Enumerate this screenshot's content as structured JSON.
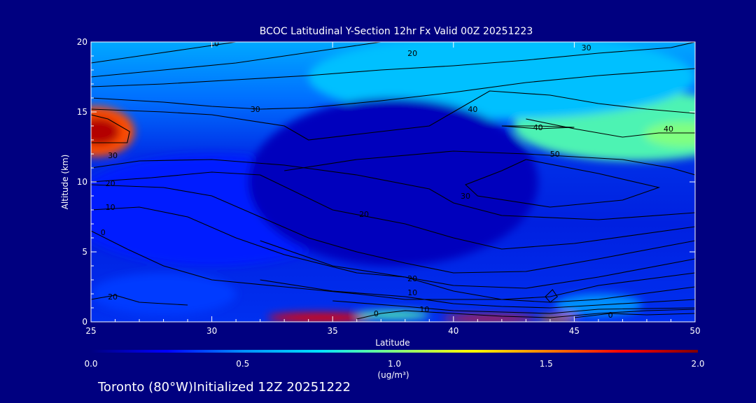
{
  "footer": "Toronto (80°W)Initialized 12Z 20251222",
  "chart_data": {
    "type": "heatmap",
    "title": "BCOC Latitudinal Y-Section 12hr  Fx Valid 00Z 20251223",
    "xlabel": "Latitude",
    "ylabel": "Altitude (km)",
    "xlim": [
      25,
      50
    ],
    "ylim": [
      0,
      20
    ],
    "x_ticks": [
      25,
      30,
      35,
      40,
      45,
      50
    ],
    "y_ticks": [
      0,
      5,
      10,
      15,
      20
    ],
    "colorbar": {
      "label": "(ug/m³)",
      "range": [
        0.0,
        2.0
      ],
      "ticks": [
        "0.0",
        "0.5",
        "1.0",
        "1.5",
        "2.0"
      ],
      "colors": [
        "#000080",
        "#0000ff",
        "#0090ff",
        "#00e0ff",
        "#80ff80",
        "#ffff00",
        "#ff8000",
        "#ff0000",
        "#800000"
      ]
    },
    "contour_lines": [
      {
        "label": "10",
        "points": [
          [
            25,
            18.5
          ],
          [
            27,
            19
          ],
          [
            29,
            19.5
          ],
          [
            31,
            20
          ]
        ],
        "label_at": [
          30.1,
          19.9
        ]
      },
      {
        "label": "20",
        "points": [
          [
            25,
            17.5
          ],
          [
            28,
            18
          ],
          [
            31,
            18.5
          ],
          [
            33,
            19
          ],
          [
            35,
            19.5
          ],
          [
            37,
            20
          ]
        ],
        "label_at": [
          38.3,
          19.2
        ]
      },
      {
        "label": "30",
        "points": [
          [
            25,
            16.8
          ],
          [
            28,
            17
          ],
          [
            31,
            17.3
          ],
          [
            34,
            17.6
          ],
          [
            37,
            18
          ],
          [
            40,
            18.3
          ],
          [
            43,
            18.7
          ],
          [
            46,
            19.2
          ],
          [
            49,
            19.6
          ],
          [
            50,
            20
          ]
        ],
        "label_at": [
          45.5,
          19.6
        ]
      },
      {
        "label": "30",
        "points": [
          [
            25,
            16
          ],
          [
            28,
            15.7
          ],
          [
            30,
            15.4
          ],
          [
            32,
            15.2
          ],
          [
            34,
            15.3
          ],
          [
            37,
            15.8
          ],
          [
            40,
            16.4
          ],
          [
            43,
            17.1
          ],
          [
            46,
            17.6
          ],
          [
            50,
            18.1
          ]
        ],
        "label_at": [
          31.8,
          15.2
        ]
      },
      {
        "label": "40",
        "points": [
          [
            25,
            15.2
          ],
          [
            28,
            15
          ],
          [
            30,
            14.8
          ],
          [
            33,
            14
          ],
          [
            34,
            13
          ],
          [
            36,
            13.4
          ],
          [
            39,
            14
          ],
          [
            40,
            15
          ],
          [
            41.5,
            16.5
          ],
          [
            44,
            16.2
          ],
          [
            46,
            15.6
          ],
          [
            48,
            15.2
          ],
          [
            50,
            14.9
          ]
        ],
        "label_at": [
          40.8,
          15.2
        ]
      },
      {
        "label": "40",
        "points": [
          [
            42,
            14
          ],
          [
            43.5,
            14
          ],
          [
            45,
            13.9
          ],
          [
            43.5,
            13.8
          ],
          [
            42,
            14
          ]
        ],
        "label_at": [
          43.5,
          13.9
        ]
      },
      {
        "label": "40",
        "points": [
          [
            43,
            14.5
          ],
          [
            45,
            13.8
          ],
          [
            47,
            13.2
          ],
          [
            48.5,
            13.5
          ],
          [
            50,
            13.5
          ]
        ],
        "label_at": [
          48.9,
          13.8
        ]
      },
      {
        "label": "30",
        "points": [
          [
            25,
            12.8
          ],
          [
            26.5,
            12.8
          ],
          [
            26.6,
            13.6
          ],
          [
            25.7,
            14.5
          ],
          [
            25,
            14.8
          ]
        ],
        "label_at": [
          25.9,
          11.9
        ]
      },
      {
        "label": "50",
        "points": [
          [
            33,
            10.8
          ],
          [
            36,
            11.6
          ],
          [
            40,
            12.2
          ],
          [
            43,
            12
          ],
          [
            47,
            11.6
          ],
          [
            49,
            11
          ],
          [
            50,
            10.5
          ]
        ],
        "label_at": [
          44.2,
          12
        ]
      },
      {
        "label": "",
        "points": [
          [
            43,
            11.6
          ],
          [
            46,
            10.6
          ],
          [
            48.5,
            9.6
          ],
          [
            47,
            8.7
          ],
          [
            44,
            8.2
          ],
          [
            41,
            9
          ],
          [
            40.5,
            9.8
          ],
          [
            42,
            10.8
          ],
          [
            43,
            11.6
          ]
        ],
        "label_at": null
      },
      {
        "label": "30",
        "points": [
          [
            25,
            11
          ],
          [
            27,
            11.5
          ],
          [
            30,
            11.6
          ],
          [
            33,
            11.2
          ],
          [
            36,
            10.5
          ],
          [
            39,
            9.5
          ],
          [
            40,
            8.5
          ],
          [
            42,
            7.6
          ],
          [
            46,
            7.3
          ],
          [
            50,
            7.8
          ]
        ],
        "label_at": [
          40.5,
          9
        ]
      },
      {
        "label": "20",
        "points": [
          [
            25,
            10
          ],
          [
            27.5,
            10.3
          ],
          [
            30,
            10.7
          ],
          [
            32,
            10.5
          ],
          [
            35,
            8
          ],
          [
            38,
            7
          ],
          [
            40,
            6
          ],
          [
            42,
            5.2
          ],
          [
            45,
            5.6
          ],
          [
            50,
            6.8
          ]
        ],
        "label_at": [
          36.3,
          7.7
        ]
      },
      {
        "label": "20",
        "points": [
          [
            25,
            9.8
          ],
          [
            28,
            9.6
          ],
          [
            30,
            9
          ],
          [
            32,
            7.5
          ],
          [
            34,
            6
          ],
          [
            36,
            5
          ],
          [
            38,
            4.2
          ],
          [
            40,
            3.5
          ],
          [
            43,
            3.6
          ],
          [
            46,
            4.5
          ],
          [
            50,
            5.8
          ]
        ],
        "label_at": [
          25.8,
          9.9
        ]
      },
      {
        "label": "10",
        "points": [
          [
            25,
            8
          ],
          [
            27,
            8.2
          ],
          [
            29,
            7.5
          ],
          [
            31,
            6
          ],
          [
            33,
            4.8
          ],
          [
            36,
            3.5
          ],
          [
            38,
            3.2
          ],
          [
            40,
            2.6
          ],
          [
            43,
            2.4
          ],
          [
            46,
            3.2
          ],
          [
            50,
            4.5
          ]
        ],
        "label_at": [
          25.8,
          8.2
        ]
      },
      {
        "label": "20",
        "points": [
          [
            32,
            5.8
          ],
          [
            35,
            4
          ],
          [
            38,
            3.2
          ],
          [
            40,
            2.2
          ],
          [
            42,
            1.6
          ],
          [
            44,
            1.8
          ],
          [
            46,
            2.6
          ],
          [
            50,
            3.5
          ]
        ],
        "label_at": [
          38.3,
          3.1
        ]
      },
      {
        "label": "0",
        "points": [
          [
            25,
            6.5
          ],
          [
            26.5,
            5.2
          ],
          [
            28,
            4
          ],
          [
            30,
            3
          ],
          [
            33,
            2.5
          ],
          [
            36,
            2
          ],
          [
            38,
            1.6
          ],
          [
            40,
            1.6
          ],
          [
            42,
            1.6
          ],
          [
            44,
            1.4
          ],
          [
            46,
            1.6
          ],
          [
            50,
            2.5
          ]
        ],
        "label_at": [
          25.5,
          6.4
        ]
      },
      {
        "label": "10",
        "points": [
          [
            32,
            3
          ],
          [
            35,
            2.2
          ],
          [
            38,
            1.8
          ],
          [
            40,
            1.3
          ],
          [
            42,
            1.1
          ],
          [
            44,
            1
          ],
          [
            46,
            1.2
          ],
          [
            50,
            1.6
          ]
        ],
        "label_at": [
          38.3,
          2.1
        ]
      },
      {
        "label": "10",
        "points": [
          [
            35,
            1.5
          ],
          [
            38,
            1.1
          ],
          [
            40,
            0.8
          ],
          [
            42,
            0.7
          ],
          [
            44,
            0.6
          ],
          [
            46,
            0.9
          ],
          [
            50,
            1
          ]
        ],
        "label_at": [
          38.8,
          0.9
        ]
      },
      {
        "label": "20",
        "points": [
          [
            25,
            1.6
          ],
          [
            26,
            1.9
          ],
          [
            27,
            1.4
          ],
          [
            29,
            1.2
          ]
        ],
        "label_at": [
          25.9,
          1.8
        ]
      },
      {
        "label": "0",
        "points": [
          [
            36,
            0.2
          ],
          [
            37,
            0.6
          ],
          [
            38,
            0.8
          ],
          [
            40,
            0.6
          ],
          [
            42,
            0.4
          ],
          [
            44,
            0.3
          ],
          [
            46,
            0.6
          ],
          [
            48,
            0.8
          ],
          [
            50,
            0.9
          ]
        ],
        "label_at": [
          36.8,
          0.6
        ]
      },
      {
        "label": "0",
        "points": [
          [
            45,
            0.3
          ],
          [
            46.5,
            0.6
          ],
          [
            48,
            0.5
          ],
          [
            50,
            0.6
          ]
        ],
        "label_at": [
          46.5,
          0.5
        ]
      },
      {
        "label": "",
        "points": [
          [
            43.8,
            1.8
          ],
          [
            44.1,
            2.3
          ],
          [
            44.3,
            1.8
          ],
          [
            44,
            1.4
          ],
          [
            43.8,
            1.8
          ]
        ],
        "label_at": null
      }
    ],
    "field_blobs": [
      {
        "lat": 25.2,
        "alt": 13.6,
        "rx": 1.6,
        "ry": 1.8,
        "value": 1.6
      },
      {
        "lat": 25.3,
        "alt": 13.6,
        "rx": 0.9,
        "ry": 1.0,
        "value": 1.9
      },
      {
        "lat": 47.5,
        "alt": 14.0,
        "rx": 5.0,
        "ry": 2.5,
        "value": 0.9
      },
      {
        "lat": 49.5,
        "alt": 13.4,
        "rx": 1.6,
        "ry": 0.9,
        "value": 1.0
      },
      {
        "lat": 42.0,
        "alt": 17.5,
        "rx": 8.0,
        "ry": 3.0,
        "value": 0.65
      },
      {
        "lat": 34.5,
        "alt": 0.3,
        "rx": 2.2,
        "ry": 0.35,
        "value": 1.8
      },
      {
        "lat": 37.5,
        "alt": 0.5,
        "rx": 1.5,
        "ry": 0.3,
        "value": 0.9
      },
      {
        "lat": 41.5,
        "alt": 0.25,
        "rx": 2.0,
        "ry": 0.2,
        "value": 1.7
      },
      {
        "lat": 44.3,
        "alt": 0.25,
        "rx": 0.8,
        "ry": 0.2,
        "value": 1.5
      },
      {
        "lat": 46.0,
        "alt": 1.2,
        "rx": 1.8,
        "ry": 0.8,
        "value": 0.5
      },
      {
        "lat": 28.0,
        "alt": 2.0,
        "rx": 3.0,
        "ry": 1.5,
        "value": 0.35
      },
      {
        "lat": 30.0,
        "alt": 8.0,
        "rx": 6.0,
        "ry": 4.0,
        "value": 0.3
      },
      {
        "lat": 37.5,
        "alt": 10.0,
        "rx": 6.0,
        "ry": 6.0,
        "value": 0.12
      }
    ]
  }
}
